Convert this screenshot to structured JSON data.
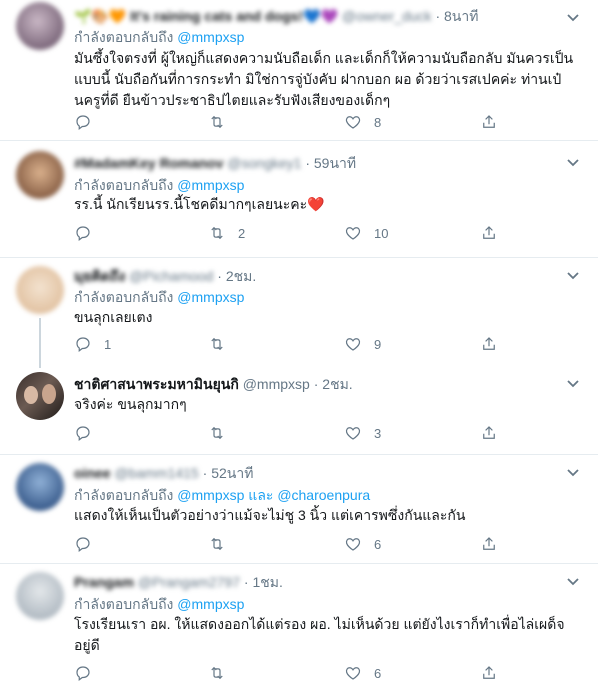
{
  "colors": {
    "accent": "#1da1f2",
    "text": "#14171a",
    "muted": "#657786",
    "divider": "#e6ecf0"
  },
  "tweets": [
    {
      "name": "🌱🎨🧡 It's raining cats and dogs!💙💜",
      "handle": "@owner_duck",
      "time": "8นาที",
      "reply_prefix": "กำลังตอบกลับถึง",
      "mentions": [
        "@mmpxsp"
      ],
      "text": "มันซึ้งใจตรงที่ ผู้ใหญ่ก็แสดงความนับถือเด็ก และเด็กก็ให้ความนับถือกลับ มันควรเป็นแบบนี้ นับถือกันที่การกระทำ มิใช่การจู่บังคับ ฝากบอก ผอ ด้วยว่าเรสเปคค่ะ ท่านเป๋นครูที่ดี ยืนข้าวประชาธิปไตยและรับฟังเสียงของเด็กๆ",
      "reply_count": "",
      "retweet_count": "",
      "like_count": "8"
    },
    {
      "name": "#MadamKey Romanov",
      "handle": "@songkey1",
      "time": "59นาที",
      "reply_prefix": "กำลังตอบกลับถึง",
      "mentions": [
        "@mmpxsp"
      ],
      "text": "รร.นี้ นักเรียนรร.นี้โชคดีมากๆเลยนะคะ❤️",
      "reply_count": "",
      "retweet_count": "2",
      "like_count": "10"
    },
    {
      "name": "มุยคิดถึง",
      "handle": "@Pichamood",
      "time": "2ชม.",
      "reply_prefix": "กำลังตอบกลับถึง",
      "mentions": [
        "@mmpxsp"
      ],
      "text": "ขนลุกเลยเตง",
      "reply_count": "1",
      "retweet_count": "",
      "like_count": "9"
    },
    {
      "name": "ชาติศาสนาพระมหามินยุนกิ",
      "handle": "@mmpxsp",
      "time": "2ชม.",
      "reply_prefix": "",
      "mentions": [],
      "text": "จริงค่ะ ขนลุกมากๆ",
      "reply_count": "",
      "retweet_count": "",
      "like_count": "3"
    },
    {
      "name": "oinee",
      "handle": "@bamm1415",
      "time": "52นาที",
      "reply_prefix": "กำลังตอบกลับถึง",
      "mentions": [
        "@mmpxsp",
        "@charoenpura"
      ],
      "mention_join": "และ",
      "text": "แสดงให้เห็นเป็นตัวอย่างว่าแม้จะไม่ชู 3 นิ้ว แต่เคารพซึ่งกันและกัน",
      "reply_count": "",
      "retweet_count": "",
      "like_count": "6"
    },
    {
      "name": "Prangam",
      "handle": "@Prangam2797",
      "time": "1ชม.",
      "reply_prefix": "กำลังตอบกลับถึง",
      "mentions": [
        "@mmpxsp"
      ],
      "text": "โรงเรียนเรา อผ. ให้แสดงออกได้แต่รอง ผอ. ไม่เห็นด้วย แต่ยังไงเราก็ทำเพื่อไล่เผด็จอยู่ดี",
      "reply_count": "",
      "retweet_count": "",
      "like_count": "6"
    }
  ]
}
